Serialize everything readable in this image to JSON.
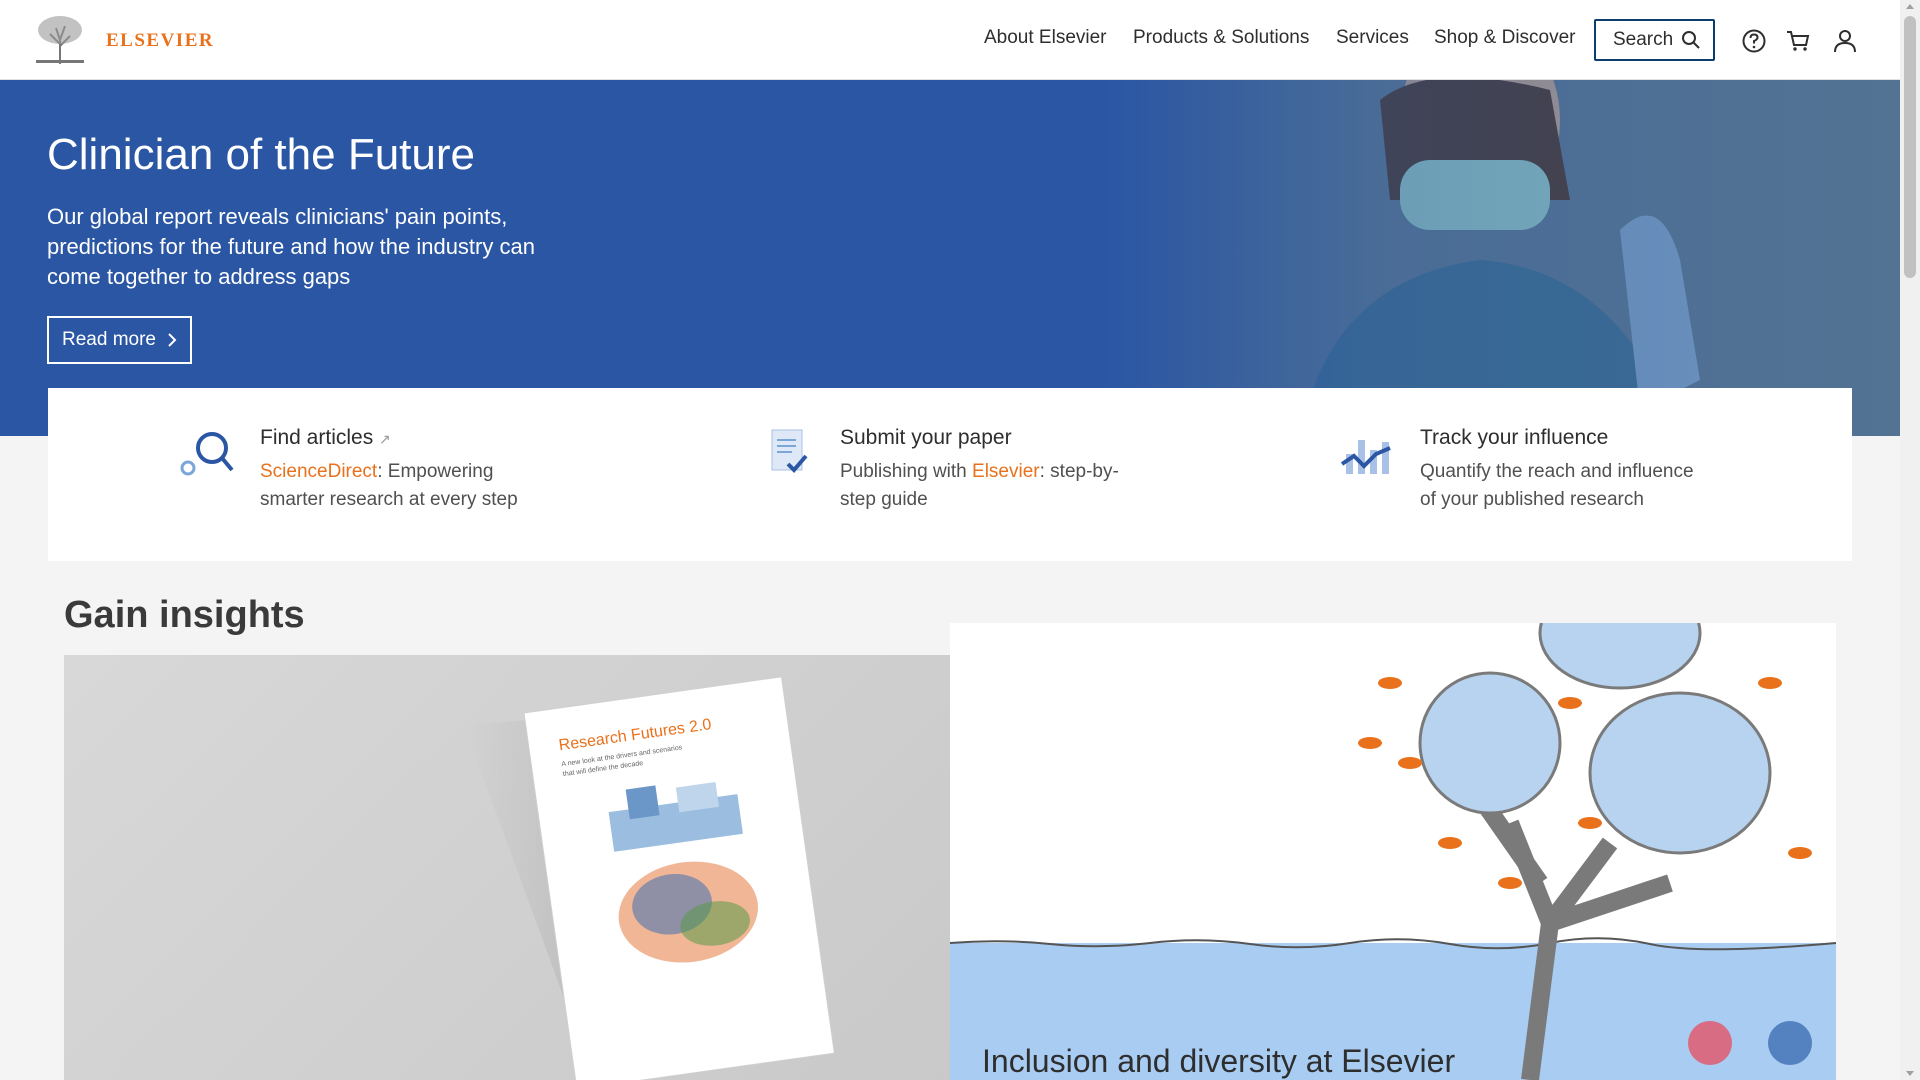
{
  "header": {
    "logo_text": "ELSEVIER",
    "nav": [
      "About Elsevier",
      "Products & Solutions",
      "Services",
      "Shop & Discover"
    ],
    "search_label": "Search",
    "accent": "#e9711c",
    "border_color": "#0c3e6d"
  },
  "hero": {
    "title": "Clinician of the Future",
    "description": "Our global report reveals clinicians' pain points, predictions for the future and how the industry can come together to address gaps",
    "cta": "Read more",
    "background": "#2a56a4"
  },
  "quick_links": [
    {
      "title": "Find articles",
      "brand": "ScienceDirect",
      "rest": ": Empowering smarter research at every step",
      "icon": "magnifier-icon",
      "external": true
    },
    {
      "title": "Submit your paper",
      "prefix": "Publishing with ",
      "brand": "Elsevier",
      "rest": ": step-by-step guide",
      "icon": "document-check-icon"
    },
    {
      "title": "Track your influence",
      "description": "Quantify the reach and influence of your published research",
      "icon": "chart-trend-icon"
    }
  ],
  "insights": {
    "title": "Gain insights",
    "book_title": "Research Futures 2.0",
    "book_subtitle": "A new look at the drivers and scenarios that will define the decade",
    "right_title": "Inclusion and diversity at Elsevier"
  }
}
